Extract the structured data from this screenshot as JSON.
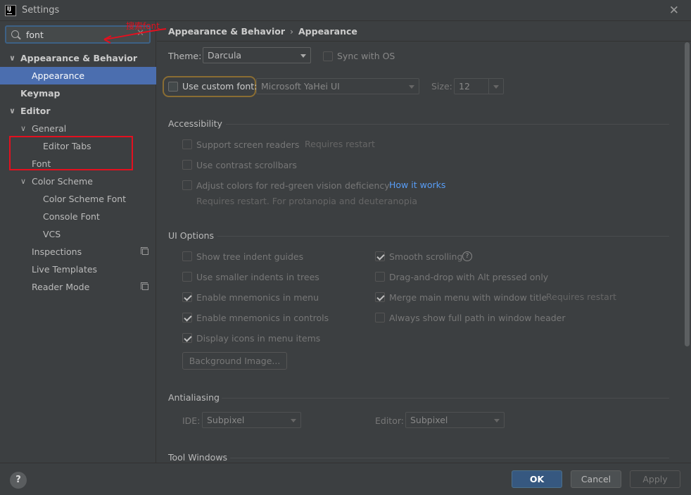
{
  "window": {
    "title": "Settings",
    "logo_text": "IJ"
  },
  "search": {
    "value": "font"
  },
  "annotation": {
    "text": "搜索font"
  },
  "sidebar": {
    "items": [
      {
        "label": "Appearance & Behavior"
      },
      {
        "label": "Appearance"
      },
      {
        "label": "Keymap"
      },
      {
        "label": "Editor"
      },
      {
        "label": "General"
      },
      {
        "label": "Editor Tabs"
      },
      {
        "label": "Font"
      },
      {
        "label": "Color Scheme"
      },
      {
        "label": "Color Scheme Font"
      },
      {
        "label": "Console Font"
      },
      {
        "label": "VCS"
      },
      {
        "label": "Inspections"
      },
      {
        "label": "Live Templates"
      },
      {
        "label": "Reader Mode"
      }
    ]
  },
  "breadcrumb": {
    "parent": "Appearance & Behavior",
    "separator": "›",
    "current": "Appearance"
  },
  "theme": {
    "label": "Theme:",
    "value": "Darcula",
    "sync_label": "Sync with OS"
  },
  "custom_font": {
    "label": "Use custom font:",
    "font_value": "Microsoft YaHei UI",
    "size_label": "Size:",
    "size_value": "12"
  },
  "accessibility": {
    "title": "Accessibility",
    "screen_readers": "Support screen readers",
    "requires_restart": "Requires restart",
    "contrast_scrollbars": "Use contrast scrollbars",
    "adjust_colors": "Adjust colors for red-green vision deficiency",
    "how_it_works": "How it works",
    "restart_note": "Requires restart. For protanopia and deuteranopia"
  },
  "ui_options": {
    "title": "UI Options",
    "tree_indent": "Show tree indent guides",
    "smaller_indents": "Use smaller indents in trees",
    "mnemonics_menu": "Enable mnemonics in menu",
    "mnemonics_controls": "Enable mnemonics in controls",
    "display_icons": "Display icons in menu items",
    "background_image": "Background Image...",
    "smooth_scrolling": "Smooth scrolling",
    "drag_drop": "Drag-and-drop with Alt pressed only",
    "merge_menu": "Merge main menu with window title",
    "merge_restart": "Requires restart",
    "full_path": "Always show full path in window header",
    "help_mark": "?"
  },
  "antialiasing": {
    "title": "Antialiasing",
    "ide_label": "IDE:",
    "ide_value": "Subpixel",
    "editor_label": "Editor:",
    "editor_value": "Subpixel"
  },
  "tool_windows": {
    "title": "Tool Windows"
  },
  "buttons": {
    "help": "?",
    "ok": "OK",
    "cancel": "Cancel",
    "apply": "Apply"
  },
  "colors": {
    "selection": "#4b6eaf",
    "link": "#589df6",
    "annotation_red": "#e3101f",
    "ok_button": "#365880"
  }
}
